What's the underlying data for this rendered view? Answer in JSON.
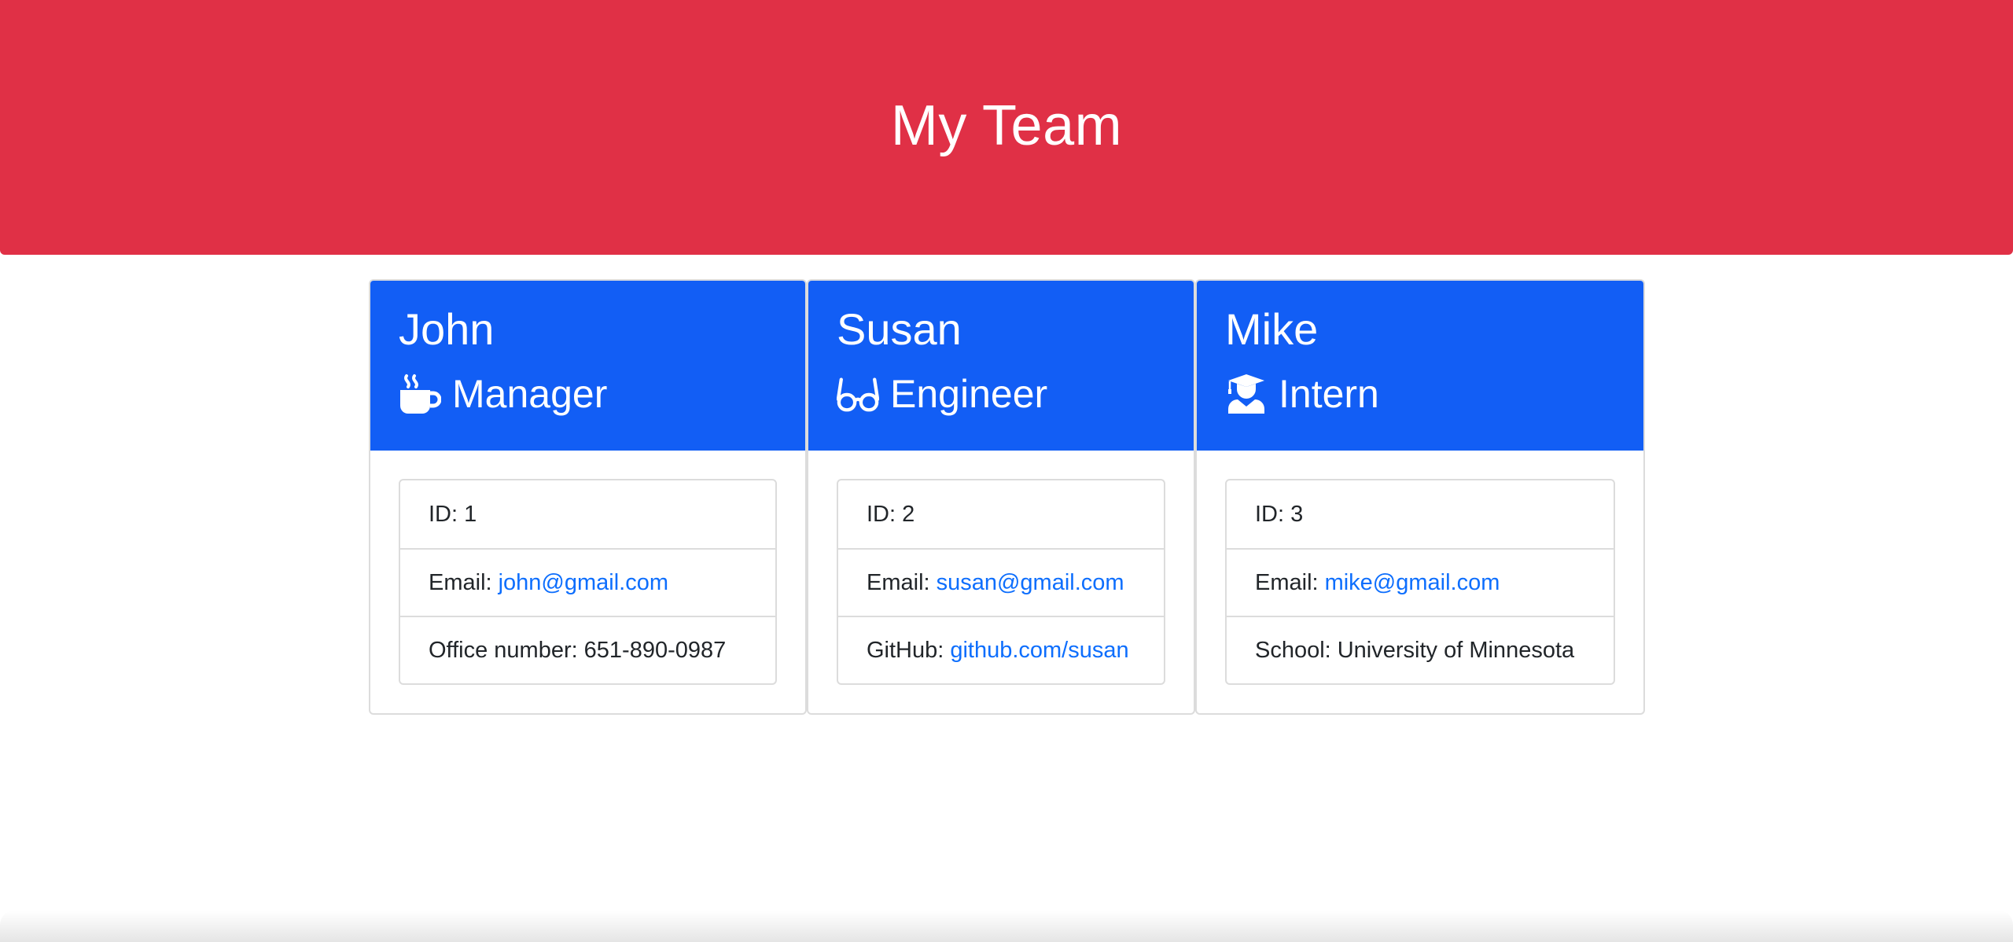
{
  "header": {
    "title": "My Team"
  },
  "colors": {
    "banner": "#e03046",
    "card_header": "#125ef5",
    "link": "#0d6efd"
  },
  "employees": [
    {
      "name": "John",
      "role": "Manager",
      "role_icon": "coffee-mug-icon",
      "id_label": "ID:",
      "id": "1",
      "email_label": "Email:",
      "email": "john@gmail.com",
      "extra_label": "Office number:",
      "extra_value": "651-890-0987"
    },
    {
      "name": "Susan",
      "role": "Engineer",
      "role_icon": "glasses-icon",
      "id_label": "ID:",
      "id": "2",
      "email_label": "Email:",
      "email": "susan@gmail.com",
      "extra_label": "GitHub:",
      "extra_value": "github.com/susan"
    },
    {
      "name": "Mike",
      "role": "Intern",
      "role_icon": "graduate-icon",
      "id_label": "ID:",
      "id": "3",
      "email_label": "Email:",
      "email": "mike@gmail.com",
      "extra_label": "School:",
      "extra_value": "University of Minnesota"
    }
  ]
}
